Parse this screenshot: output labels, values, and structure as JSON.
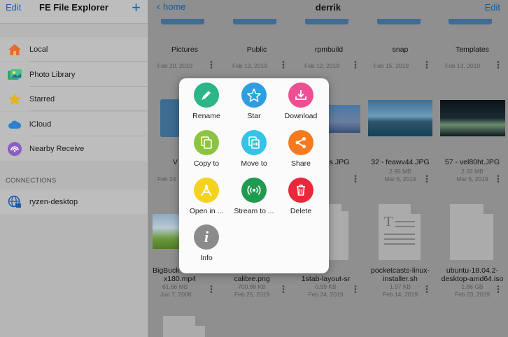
{
  "sidebar": {
    "edit_label": "Edit",
    "title": "FE File Explorer",
    "add_label": "+",
    "items": [
      {
        "label": "Local",
        "icon": "house-icon"
      },
      {
        "label": "Photo Library",
        "icon": "photo-library-icon"
      },
      {
        "label": "Starred",
        "icon": "star-icon"
      },
      {
        "label": "iCloud",
        "icon": "cloud-icon"
      },
      {
        "label": "Nearby Receive",
        "icon": "nearby-receive-icon"
      }
    ],
    "connections_heading": "CONNECTIONS",
    "connections": [
      {
        "label": "ryzen-desktop",
        "icon": "network-globe-icon"
      }
    ]
  },
  "main": {
    "back_label": "home",
    "folder_title": "derrik",
    "edit_label": "Edit",
    "row1": [
      {
        "name": "Pictures",
        "date": "Feb 20, 2019"
      },
      {
        "name": "Public",
        "date": "Feb 13, 2019"
      },
      {
        "name": "rpmbuild",
        "date": "Feb 12, 2019"
      },
      {
        "name": "snap",
        "date": "Feb 15, 2019"
      },
      {
        "name": "Templates",
        "date": "Feb 13, 2019"
      }
    ],
    "row2": [
      {
        "name": "V",
        "size": "",
        "date": "Feb 24"
      },
      {
        "name": "",
        "size": "",
        "date": ""
      },
      {
        "name": "rj4s.JPG",
        "size": "",
        "date": ""
      },
      {
        "name": "32 - feawv44.JPG",
        "size": "2.95 MB",
        "date": "Mar 6, 2019"
      },
      {
        "name": "57 - vel80ht.JPG",
        "size": "2.32 MB",
        "date": "Mar 6, 2019"
      }
    ],
    "row3": [
      {
        "name1": "BigBuck",
        "name2": "x180.mp4",
        "size": "61.66 MB",
        "date": "Jun 7, 2008"
      },
      {
        "name1": "",
        "name2": "calibre.png",
        "size": "700.88 KB",
        "date": "Feb 25, 2019"
      },
      {
        "name1": "",
        "name2": "1stab-layout-sr",
        "size": "0.99 KB",
        "date": "Feb 24, 2019"
      },
      {
        "name1": "pocketcasts-linux-",
        "name2": "installer.sh",
        "size": "1.97 KB",
        "date": "Feb 14, 2019"
      },
      {
        "name1": "ubuntu-18.04.2-",
        "name2": "desktop-amd64.iso",
        "size": "1.86 GB",
        "date": "Feb 23, 2019"
      }
    ]
  },
  "popover": {
    "actions": [
      {
        "label": "Rename",
        "icon": "pencil-icon",
        "color": "#2bb588"
      },
      {
        "label": "Star",
        "icon": "star-outline-icon",
        "color": "#2f9ee0"
      },
      {
        "label": "Download",
        "icon": "download-icon",
        "color": "#ee4f93"
      },
      {
        "label": "Copy to",
        "icon": "copy-icon",
        "color": "#8cc43f"
      },
      {
        "label": "Move to",
        "icon": "move-icon",
        "color": "#35c2e6"
      },
      {
        "label": "Share",
        "icon": "share-icon",
        "color": "#f57a1e"
      },
      {
        "label": "Open in ...",
        "icon": "open-in-icon",
        "color": "#f4d21e"
      },
      {
        "label": "Stream to ...",
        "icon": "stream-icon",
        "color": "#1e9b4e"
      },
      {
        "label": "Delete",
        "icon": "trash-icon",
        "color": "#e8283b"
      },
      {
        "label": "Info",
        "icon": "info-icon",
        "color": "#8b8b8b"
      }
    ]
  }
}
